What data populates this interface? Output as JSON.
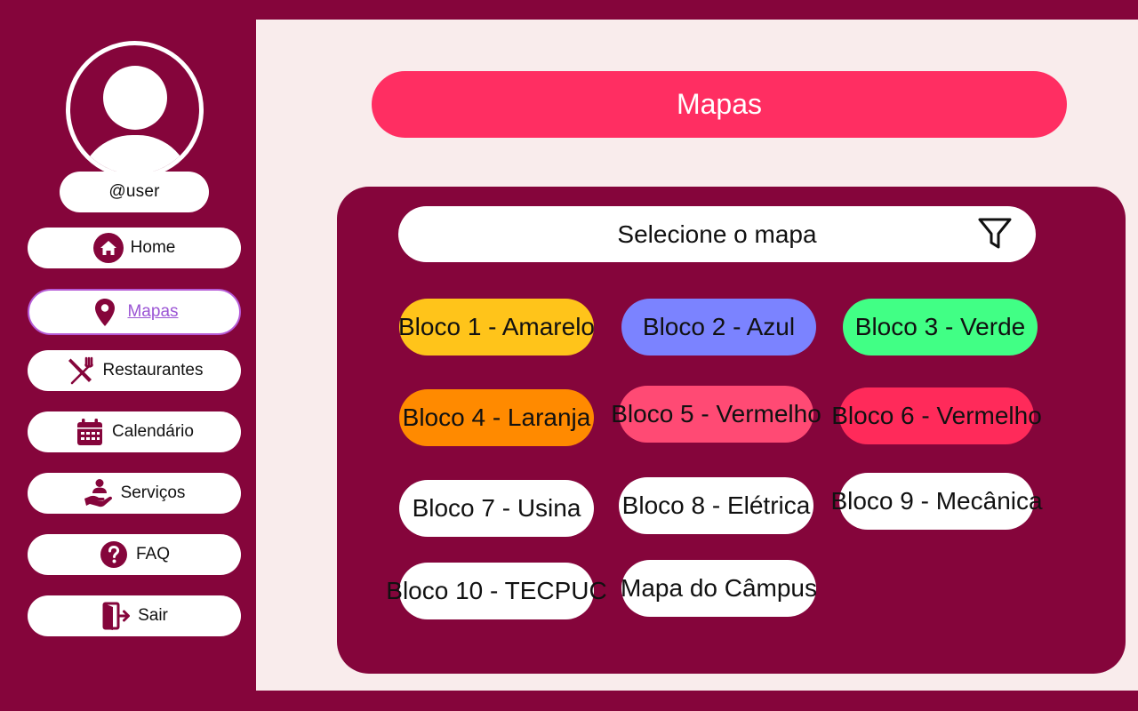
{
  "user": {
    "handle": "@user"
  },
  "nav": {
    "items": [
      {
        "id": "home",
        "label": "Home",
        "icon": "home-icon"
      },
      {
        "id": "mapas",
        "label": "Mapas",
        "icon": "map-pin-icon",
        "active": true
      },
      {
        "id": "restaurantes",
        "label": "Restaurantes",
        "icon": "utensils-icon"
      },
      {
        "id": "calendario",
        "label": "Calendário",
        "icon": "calendar-icon"
      },
      {
        "id": "servicos",
        "label": "Serviços",
        "icon": "service-hand-icon"
      },
      {
        "id": "faq",
        "label": "FAQ",
        "icon": "question-icon"
      },
      {
        "id": "sair",
        "label": "Sair",
        "icon": "logout-icon"
      }
    ]
  },
  "header": {
    "title": "Mapas"
  },
  "selector": {
    "label": "Selecione o mapa",
    "icon": "filter-icon"
  },
  "blocks": [
    {
      "label": "Bloco 1 - Amarelo",
      "color": "#ffc41a"
    },
    {
      "label": "Bloco 2 - Azul",
      "color": "#7b83ff"
    },
    {
      "label": "Bloco 3 - Verde",
      "color": "#41ff85"
    },
    {
      "label": "Bloco 4 - Laranja",
      "color": "#ff8a00"
    },
    {
      "label": "Bloco 5 - Vermelho",
      "color": "#ff4a74"
    },
    {
      "label": "Bloco 6 - Vermelho",
      "color": "#ff2a5a"
    },
    {
      "label": "Bloco 7 - Usina",
      "color": "#ffffff"
    },
    {
      "label": "Bloco 8 - Elétrica",
      "color": "#ffffff"
    },
    {
      "label": "Bloco 9 - Mecânica",
      "color": "#ffffff"
    },
    {
      "label": "Bloco 10 - TECPUC",
      "color": "#ffffff"
    },
    {
      "label": "Mapa do Câmpus",
      "color": "#ffffff"
    }
  ],
  "colors": {
    "background": "#85053b",
    "panel": "#f9ecec",
    "accent": "#ff2e62",
    "active_border": "#b55ad6",
    "active_text": "#9b55d4"
  }
}
